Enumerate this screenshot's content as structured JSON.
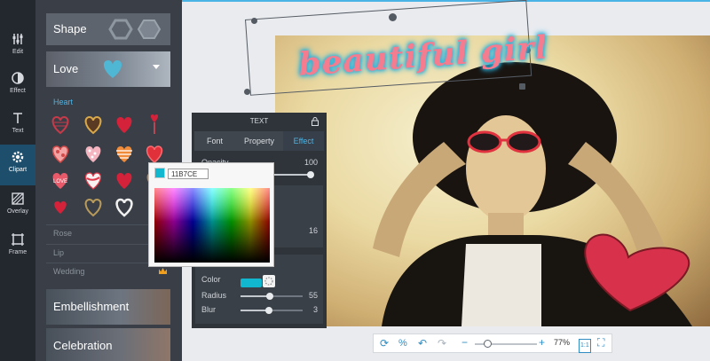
{
  "toolbar": {
    "items": [
      {
        "label": "Edit",
        "icon": "sliders-icon"
      },
      {
        "label": "Effect",
        "icon": "contrast-icon"
      },
      {
        "label": "Text",
        "icon": "text-icon"
      },
      {
        "label": "Clipart",
        "icon": "gear-icon",
        "active": true
      },
      {
        "label": "Overlay",
        "icon": "overlay-icon"
      },
      {
        "label": "Frame",
        "icon": "frame-icon"
      }
    ]
  },
  "panel": {
    "shape_label": "Shape",
    "love_label": "Love",
    "heart_heading": "Heart",
    "rose_label": "Rose",
    "lip_label": "Lip",
    "wedding_label": "Wedding",
    "embellishment_label": "Embellishment",
    "celebration_label": "Celebration"
  },
  "canvas": {
    "overlay_text": "beautiful girl"
  },
  "text_panel": {
    "title": "TEXT",
    "tabs": [
      "Font",
      "Property",
      "Effect"
    ],
    "active_tab": "Effect",
    "opacity_label": "Opacity",
    "opacity_value": "100",
    "size_value": "16",
    "color_label": "Color",
    "radius_label": "Radius",
    "radius_value": "55",
    "blur_label": "Blur",
    "blur_value": "3",
    "color_hex": "#11B7CE"
  },
  "color_picker": {
    "hex_value": "11B7CE"
  },
  "zoom": {
    "percent": "77%",
    "ratio_label": "1:1",
    "level": 0.2
  },
  "colors": {
    "accent": "#4ab3e6",
    "selected_color": "#11b7ce"
  }
}
